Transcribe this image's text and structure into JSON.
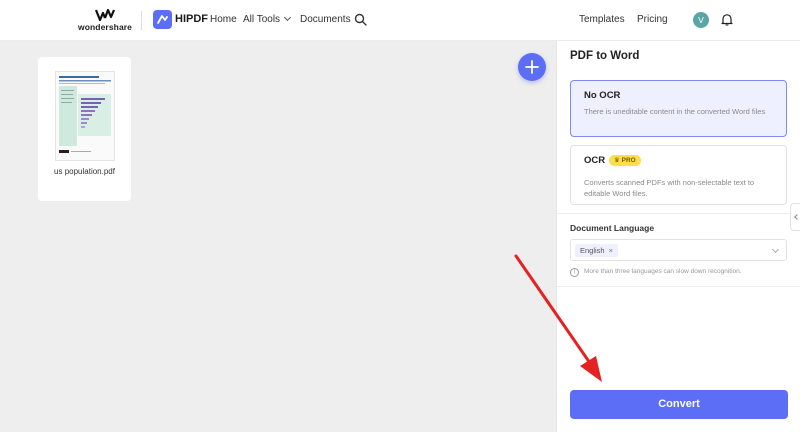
{
  "header": {
    "brand": "wondershare",
    "product": "HIPDF",
    "nav": {
      "home": "Home",
      "all_tools": "All Tools",
      "documents": "Documents"
    },
    "right_nav": {
      "templates": "Templates",
      "pricing": "Pricing"
    },
    "avatar_initial": "V"
  },
  "workspace": {
    "file": {
      "name": "us population.pdf"
    },
    "add_button_icon": "plus-icon"
  },
  "panel": {
    "title": "PDF to Word",
    "options": [
      {
        "title": "No OCR",
        "description": "There is uneditable content in the converted Word files",
        "selected": true
      },
      {
        "title": "OCR",
        "badge": "PRO",
        "description": "Converts scanned PDFs with non-selectable text to editable Word files.",
        "selected": false
      }
    ],
    "language": {
      "label": "Document Language",
      "selected": "English",
      "hint": "More than three languages can slow down recognition."
    },
    "convert_label": "Convert"
  },
  "colors": {
    "accent": "#5b6ef5",
    "annotation_arrow": "#e52222",
    "pro_badge": "#fde047",
    "avatar": "#5aa6a6"
  }
}
